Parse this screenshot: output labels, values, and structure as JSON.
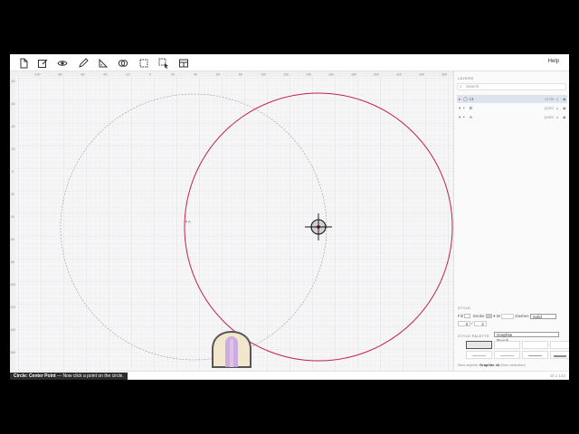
{
  "toolbar": {
    "tools": [
      {
        "name": "new-document-icon"
      },
      {
        "name": "edit-document-icon"
      },
      {
        "name": "eye-icon"
      },
      {
        "name": "pencil-icon"
      },
      {
        "name": "triangle-ruler-icon"
      },
      {
        "name": "intersect-circles-icon"
      },
      {
        "name": "select-box-icon"
      },
      {
        "name": "select-pointer-icon"
      },
      {
        "name": "layout-icon"
      }
    ],
    "help_label": "Help"
  },
  "canvas": {
    "ruler_x_labels": [
      "-100",
      "-80",
      "-60",
      "-40",
      "-20",
      "0",
      "20",
      "40",
      "60",
      "80",
      "100",
      "120",
      "140",
      "160",
      "180",
      "200",
      "220",
      "240",
      "260"
    ],
    "ruler_y_labels": [
      "-80",
      "-60",
      "-40",
      "-20",
      "0",
      "20",
      "40",
      "60",
      "80",
      "100",
      "120",
      "140",
      "160",
      "180",
      "200",
      "220",
      "240"
    ],
    "point_label": "A",
    "circle_color": "#c0244a",
    "guide_circle_color": "#9a9a9a"
  },
  "layers": {
    "heading": "LAYERS",
    "search_placeholder": "Search",
    "rows": [
      {
        "name": "c1",
        "type": "circle",
        "selected": true,
        "chev": "▸",
        "kind": "◯"
      },
      {
        "name": "B",
        "type": "point",
        "selected": false,
        "chev": "▾",
        "kind": "•"
      },
      {
        "name": "A",
        "type": "point",
        "selected": false,
        "chev": "▾",
        "kind": "•"
      }
    ]
  },
  "style": {
    "heading": "STYLE",
    "fill_label": "Fill",
    "stroke_label": "Stroke",
    "width_label": "W",
    "dashes_label": "Dashes",
    "dashes_value": "Solid",
    "dash_a": "3",
    "dash_sep": "/",
    "dash_b": "2"
  },
  "palette": {
    "heading": "STYLE PALETTE",
    "selected": "Graphite",
    "reset_label": "Re-ink",
    "new_objects_label": "New objects:",
    "new_objects_value": "Graphite",
    "count": "44",
    "count_suffix": "(from selection)"
  },
  "status": {
    "mode": "Circle: Center Point",
    "hint": "— Now click a point on the circle.",
    "coords": "x0.1 143"
  }
}
